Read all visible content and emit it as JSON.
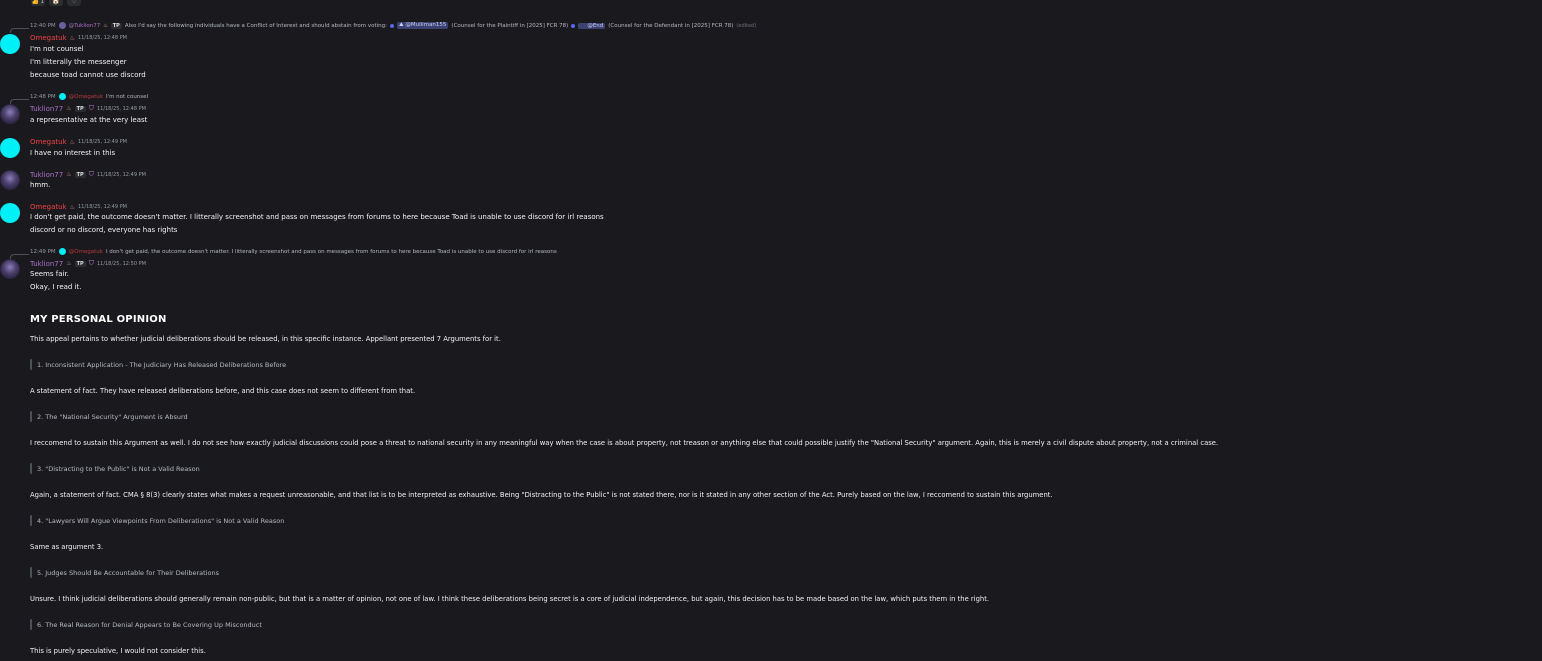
{
  "reactions": [
    {
      "icon": "thumbs-up-icon",
      "glyph": "👍",
      "count": "1"
    },
    {
      "icon": "house-icon",
      "glyph": "🏠",
      "count": ""
    },
    {
      "icon": "heart-icon",
      "glyph": "♡",
      "count": ""
    }
  ],
  "colors": {
    "background": "#1a1a1e",
    "omegatuk": "#ed4245",
    "tuklion": "#a970c8",
    "mention": "#3c4270",
    "avatar_cyan": "#00f0f8"
  },
  "reply1": {
    "time": "12:40 PM",
    "author": "@Tuklion77",
    "tag": "TP",
    "text": "Also I'd say the following individuals have a Conflict of Interest and should abstain from voting:",
    "mention1": "@Muliiman155",
    "note1": "(Counsel for the Plaintiff in [2025] FCR 78)",
    "mention2": "@End",
    "note2": "(Counsel for the Defendant in [2025] FCR 78)",
    "edited": "(edited)"
  },
  "msg1": {
    "author": "Omegatuk",
    "time": "11/18/25, 12:48 PM",
    "lines": [
      "I'm not counsel",
      "I'm litterally the messenger",
      "because toad cannot use discord"
    ]
  },
  "reply2": {
    "time": "12:48 PM",
    "author": "@Omegatuk",
    "text": "I'm not counsel"
  },
  "msg2": {
    "author": "Tuklion77",
    "tag": "TP",
    "time": "11/18/25, 12:48 PM",
    "lines": [
      "a representative at the very least"
    ]
  },
  "msg3": {
    "author": "Omegatuk",
    "time": "11/18/25, 12:49 PM",
    "lines": [
      "I have no interest in this"
    ]
  },
  "msg4": {
    "author": "Tuklion77",
    "tag": "TP",
    "time": "11/18/25, 12:49 PM",
    "lines": [
      "hmm."
    ]
  },
  "msg5": {
    "author": "Omegatuk",
    "time": "11/18/25, 12:49 PM",
    "lines": [
      "I don't get paid, the outcome doesn't matter. I litterally screenshot and pass on messages from forums to here because Toad is unable to use discord for irl reasons",
      "discord or no discord, everyone has rights"
    ]
  },
  "reply3": {
    "time": "12:49 PM",
    "author": "@Omegatuk",
    "text": "I don't get paid, the outcome doesn't matter. I litterally screenshot and pass on messages from forums to here because Toad is unable to use discord for irl reasons"
  },
  "msg6": {
    "author": "Tuklion77",
    "tag": "TP",
    "time": "11/18/25, 12:50 PM",
    "lines": [
      "Seems fair.",
      "Okay, I read it."
    ]
  },
  "opinion": {
    "heading": "MY PERSONAL OPINION",
    "intro": "This appeal pertains to whether judicial deliberations should be released, in this specific instance. Appellant presented 7 Arguments for it.",
    "q1": "1. Inconsistent Application - The Judiciary Has Released Deliberations Before",
    "a1": "A statement of fact. They have released deliberations before, and this case does not seem to different from that.",
    "q2": "2. The \"National Security\" Argument is Absurd",
    "a2": "I reccomend to sustain this Argument as well. I do not see how exactly judicial discussions could pose a threat to national security in any meaningful way when the case is about property, not treason or anything else that could possible justify the \"National Security\" argument. Again, this is merely a civil dispute about property, not a criminal case.",
    "q3": "3. \"Distracting to the Public\" is Not a Valid Reason",
    "a3": "Again, a statement of fact. CMA § 8(3) clearly states what makes a request unreasonable, and that list is to be interpreted as exhaustive. Being \"Distracting to the Public\" is not stated there, nor is it stated in any other section of the Act. Purely based on the law, I reccomend to sustain this argument.",
    "q4": "4. \"Lawyers Will Argue Viewpoints From Deliberations\" is Not a Valid Reason",
    "a4": "Same as argument 3.",
    "q5": "5. Judges Should Be Accountable for Their Deliberations",
    "a5": "Unsure. I think judicial deliberations should generally remain non-public, but that is a matter of opinion, not one of law. I think these deliberations being secret is a core of judicial independence, but again, this decision has to be made based on the law, which puts them in the right.",
    "q6": "6. The Real Reason for Denial Appears to Be Covering Up Misconduct",
    "a6": "This is purely speculative, I would not consider this."
  }
}
